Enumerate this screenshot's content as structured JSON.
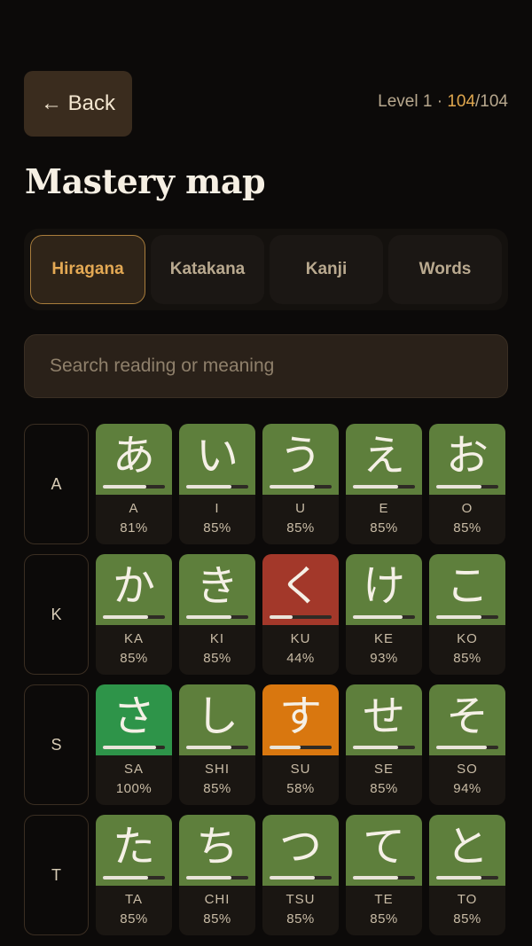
{
  "header": {
    "back_label": "← Back",
    "level_prefix": "Level 1 · ",
    "level_current": "104",
    "level_total": "/104"
  },
  "title": "Mastery map",
  "tabs": [
    {
      "label": "Hiragana",
      "active": true
    },
    {
      "label": "Katakana",
      "active": false
    },
    {
      "label": "Kanji",
      "active": false
    },
    {
      "label": "Words",
      "active": false
    }
  ],
  "search": {
    "placeholder": "Search reading or meaning"
  },
  "colors": {
    "mastered": "#5e7f3c",
    "complete": "#2e9449",
    "weak": "#a3382a",
    "learning": "#d9770f",
    "accent": "#e0a74e"
  },
  "rows": [
    {
      "label": "A",
      "cells": [
        {
          "kana": "あ",
          "romaji": "A",
          "percent": "81%",
          "value": 81,
          "status": "green"
        },
        {
          "kana": "い",
          "romaji": "I",
          "percent": "85%",
          "value": 85,
          "status": "green"
        },
        {
          "kana": "う",
          "romaji": "U",
          "percent": "85%",
          "value": 85,
          "status": "green"
        },
        {
          "kana": "え",
          "romaji": "E",
          "percent": "85%",
          "value": 85,
          "status": "green"
        },
        {
          "kana": "お",
          "romaji": "O",
          "percent": "85%",
          "value": 85,
          "status": "green"
        }
      ]
    },
    {
      "label": "K",
      "cells": [
        {
          "kana": "か",
          "romaji": "KA",
          "percent": "85%",
          "value": 85,
          "status": "green"
        },
        {
          "kana": "き",
          "romaji": "KI",
          "percent": "85%",
          "value": 85,
          "status": "green"
        },
        {
          "kana": "く",
          "romaji": "KU",
          "percent": "44%",
          "value": 44,
          "status": "red"
        },
        {
          "kana": "け",
          "romaji": "KE",
          "percent": "93%",
          "value": 93,
          "status": "green"
        },
        {
          "kana": "こ",
          "romaji": "KO",
          "percent": "85%",
          "value": 85,
          "status": "green"
        }
      ]
    },
    {
      "label": "S",
      "cells": [
        {
          "kana": "さ",
          "romaji": "SA",
          "percent": "100%",
          "value": 100,
          "status": "bright"
        },
        {
          "kana": "し",
          "romaji": "SHI",
          "percent": "85%",
          "value": 85,
          "status": "green"
        },
        {
          "kana": "す",
          "romaji": "SU",
          "percent": "58%",
          "value": 58,
          "status": "orange"
        },
        {
          "kana": "せ",
          "romaji": "SE",
          "percent": "85%",
          "value": 85,
          "status": "green"
        },
        {
          "kana": "そ",
          "romaji": "SO",
          "percent": "94%",
          "value": 94,
          "status": "green"
        }
      ]
    },
    {
      "label": "T",
      "cells": [
        {
          "kana": "た",
          "romaji": "TA",
          "percent": "85%",
          "value": 85,
          "status": "green"
        },
        {
          "kana": "ち",
          "romaji": "CHI",
          "percent": "85%",
          "value": 85,
          "status": "green"
        },
        {
          "kana": "つ",
          "romaji": "TSU",
          "percent": "85%",
          "value": 85,
          "status": "green"
        },
        {
          "kana": "て",
          "romaji": "TE",
          "percent": "85%",
          "value": 85,
          "status": "green"
        },
        {
          "kana": "と",
          "romaji": "TO",
          "percent": "85%",
          "value": 85,
          "status": "green"
        }
      ]
    }
  ]
}
